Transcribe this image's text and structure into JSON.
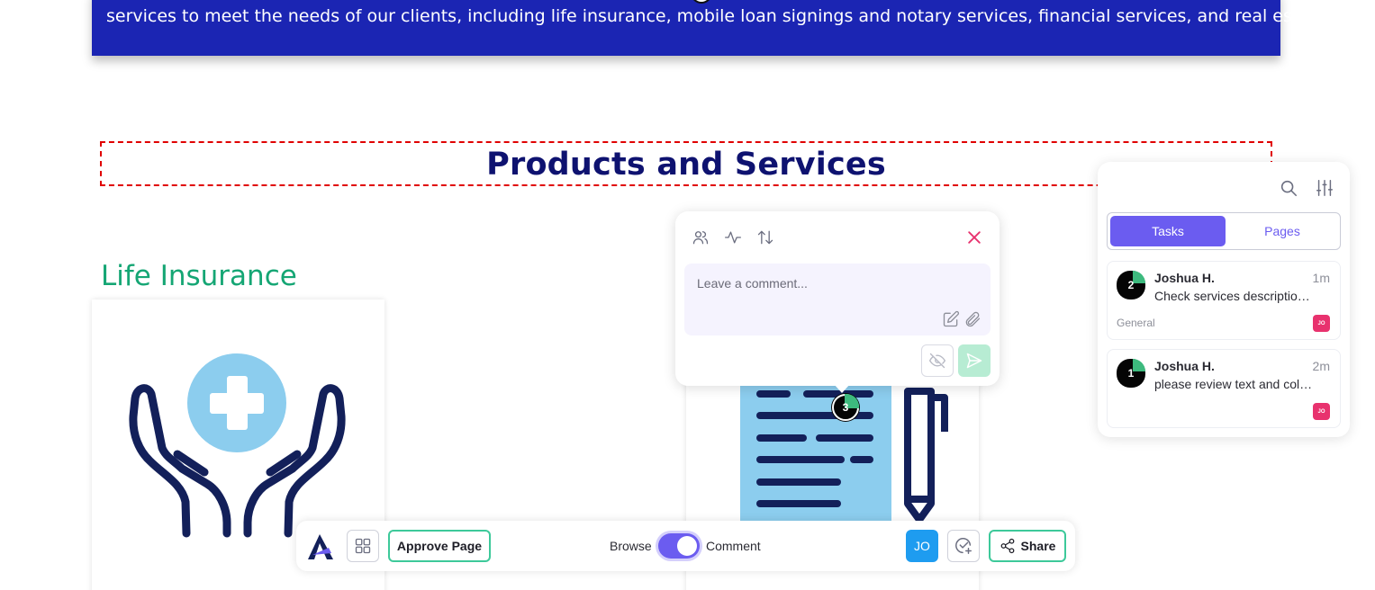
{
  "banner": {
    "text": "services to meet the needs of our clients, including life insurance, mobile loan signings and notary services, financial services, and real estate services."
  },
  "section": {
    "title": "Products and Services"
  },
  "cards": [
    {
      "title": "Life Insurance",
      "icon": "hands-medical-cross-icon"
    },
    {
      "title": "",
      "icon": "document-pen-icon"
    }
  ],
  "comment_popup": {
    "placeholder": "Leave a comment...",
    "pin_number": "3",
    "icons": [
      "users-icon",
      "activity-icon",
      "sort-icon",
      "close-icon",
      "edit-icon",
      "paperclip-icon",
      "eye-off-icon",
      "send-icon"
    ]
  },
  "panel": {
    "tabs": [
      {
        "label": "Tasks",
        "active": true
      },
      {
        "label": "Pages",
        "active": false
      }
    ],
    "tasks": [
      {
        "number": "2",
        "author": "Joshua H.",
        "time": "1m",
        "text": "Check services descriptio…",
        "category": "General",
        "avatar": "JO"
      },
      {
        "number": "1",
        "author": "Joshua H.",
        "time": "2m",
        "text": "please review text and col…",
        "category": "",
        "avatar": "JO"
      }
    ]
  },
  "toolbar": {
    "approve_label": "Approve Page",
    "browse_label": "Browse",
    "comment_label": "Comment",
    "mode": "Comment",
    "user_initials": "JO",
    "share_label": "Share"
  },
  "colors": {
    "banner_bg": "#1b25b3",
    "title": "#0e1270",
    "card_title": "#15a674",
    "accent": "#6b5cf0",
    "success_border": "#3dc99a",
    "close": "#e8326e"
  }
}
